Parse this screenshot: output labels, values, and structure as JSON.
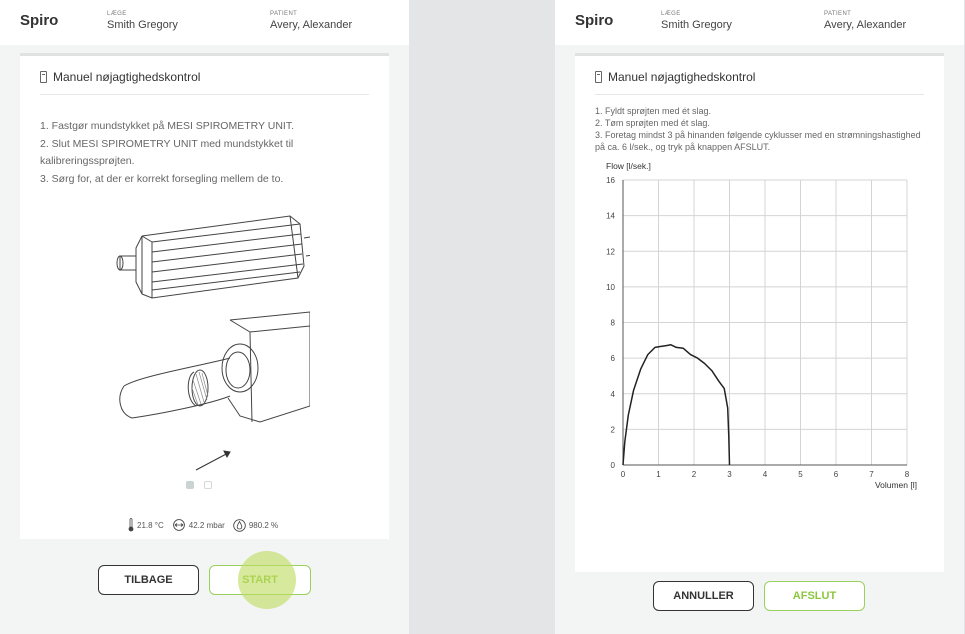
{
  "app_title": "Spiro",
  "header": {
    "doctor_label": "LÆGE",
    "doctor_name": "Smith Gregory",
    "patient_label": "PATIENT",
    "patient_name": "Avery, Alexander"
  },
  "left": {
    "card_title": "Manuel nøjagtighedskontrol",
    "steps": [
      "1. Fastgør mundstykket på MESI SPIROMETRY UNIT.",
      "2. Slut MESI SPIROMETRY UNIT med mundstykket til kalibreringssprøjten.",
      "3. Sørg for, at der er korrekt forsegling mellem de to."
    ],
    "carousel": {
      "current": 1,
      "total": 2
    },
    "env": {
      "temperature": "21.8 °C",
      "pressure": "42.2 mbar",
      "humidity": "980.2 %"
    },
    "buttons": {
      "back": "TILBAGE",
      "start": "START"
    }
  },
  "right": {
    "card_title": "Manuel nøjagtighedskontrol",
    "steps": [
      "1. Fyldt sprøjten med ét slag.",
      "2. Tøm sprøjten med ét slag.",
      "3. Foretag mindst 3 på hinanden følgende cyklusser med en strømningshastighed på ca. 6 l/sek., og tryk på knappen AFSLUT."
    ],
    "buttons": {
      "cancel": "ANNULLER",
      "finish": "AFSLUT"
    }
  },
  "colors": {
    "accent_green": "#8cc63f",
    "touch_highlight": "#bedc5f"
  },
  "chart_data": {
    "type": "line",
    "ylabel": "Flow [l/sek.]",
    "xlabel": "Volumen [l]",
    "xlim": [
      0,
      8
    ],
    "ylim": [
      0,
      16
    ],
    "xticks": [
      0,
      1,
      2,
      3,
      4,
      5,
      6,
      7,
      8
    ],
    "yticks": [
      0,
      2,
      4,
      6,
      8,
      10,
      12,
      14,
      16
    ],
    "grid": true,
    "series": [
      {
        "x": [
          0,
          0.05,
          0.15,
          0.3,
          0.5,
          0.7,
          0.9,
          1.05,
          1.2,
          1.35,
          1.5,
          1.7,
          1.9,
          2.1,
          2.3,
          2.5,
          2.7,
          2.85,
          2.95,
          2.98,
          3.0
        ],
        "y": [
          0,
          1.3,
          2.8,
          4.2,
          5.4,
          6.2,
          6.6,
          6.65,
          6.7,
          6.75,
          6.6,
          6.55,
          6.2,
          6.0,
          5.7,
          5.3,
          4.7,
          4.3,
          3.2,
          1.6,
          0
        ]
      }
    ]
  }
}
